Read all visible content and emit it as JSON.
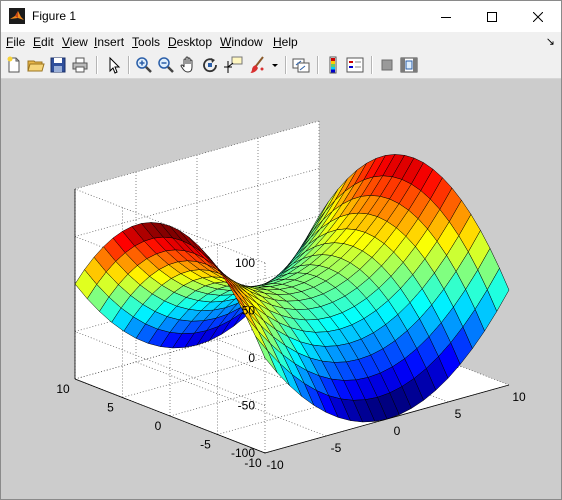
{
  "window": {
    "title": "Figure 1"
  },
  "menu": {
    "items": [
      {
        "label": "File",
        "acc": "F",
        "rest": "ile"
      },
      {
        "label": "Edit",
        "acc": "E",
        "rest": "dit"
      },
      {
        "label": "View",
        "acc": "V",
        "rest": "iew"
      },
      {
        "label": "Insert",
        "acc": "I",
        "rest": "nsert"
      },
      {
        "label": "Tools",
        "acc": "T",
        "rest": "ools"
      },
      {
        "label": "Desktop",
        "acc": "D",
        "rest": "esktop"
      },
      {
        "label": "Window",
        "acc": "W",
        "rest": "indow"
      },
      {
        "label": "Help",
        "acc": "H",
        "rest": "elp"
      }
    ],
    "dock_icon": "dock-arrow-icon"
  },
  "toolbar": {
    "buttons": [
      "new-figure-icon",
      "open-file-icon",
      "save-figure-icon",
      "print-figure-icon",
      "edit-plot-arrow-icon",
      "zoom-in-icon",
      "zoom-out-icon",
      "pan-hand-icon",
      "rotate-3d-icon",
      "data-cursor-icon",
      "brush-icon",
      "brush-dropdown-icon",
      "link-plot-icon",
      "insert-colorbar-icon",
      "insert-legend-icon",
      "hide-plot-tools-icon",
      "show-plot-tools-icon"
    ]
  },
  "chart_data": {
    "type": "surface",
    "function": "z = x^2 - y^2",
    "x": [
      -10,
      -9,
      -8,
      -7,
      -6,
      -5,
      -4,
      -3,
      -2,
      -1,
      0,
      1,
      2,
      3,
      4,
      5,
      6,
      7,
      8,
      9,
      10
    ],
    "y": [
      -10,
      -9,
      -8,
      -7,
      -6,
      -5,
      -4,
      -3,
      -2,
      -1,
      0,
      1,
      2,
      3,
      4,
      5,
      6,
      7,
      8,
      9,
      10
    ],
    "colormap": "jet",
    "xlim": [
      -10,
      10
    ],
    "ylim": [
      -10,
      10
    ],
    "zlim": [
      -100,
      100
    ],
    "x_ticks": [
      "-10",
      "-5",
      "0",
      "5",
      "10"
    ],
    "y_ticks": [
      "-10",
      "-5",
      "0",
      "5",
      "10"
    ],
    "z_ticks": [
      "-100",
      "-50",
      "0",
      "50",
      "100"
    ],
    "grid": true,
    "box": true
  }
}
